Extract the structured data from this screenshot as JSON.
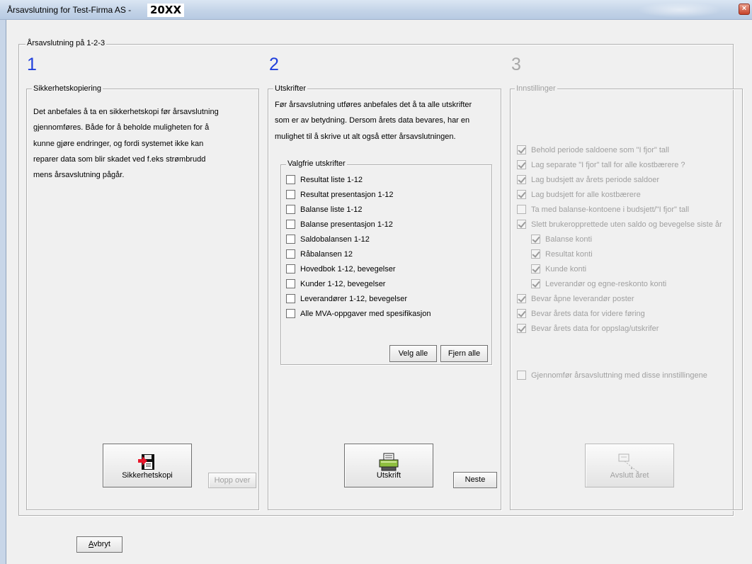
{
  "window": {
    "title": "Årsavslutning for Test-Firma AS -",
    "year": "20XX",
    "close_glyph": "×"
  },
  "main_group": {
    "label": "Årsavslutning på 1-2-3"
  },
  "step1": {
    "number": "1",
    "group_label": "Sikkerhetskopiering",
    "text_lines": [
      "Det anbefales å ta en sikkerhetskopi før årsavslutning",
      "gjennomføres. Både for å beholde muligheten for å",
      "kunne gjøre endringer, og fordi systemet ikke kan",
      "reparer data som blir skadet ved f.eks strømbrudd",
      "mens årsavslutning pågår."
    ],
    "backup_button": "Sikkerhetskopi",
    "skip_button": "Hopp over"
  },
  "step2": {
    "number": "2",
    "group_label": "Utskrifter",
    "text_lines": [
      "Før årsavslutning utføres anbefales det å ta alle utskrifter",
      "som er av betydning. Dersom årets data bevares, har en",
      "mulighet til å skrive ut alt også etter årsavslutningen."
    ],
    "optional_group_label": "Valgfrie utskrifter",
    "reports": [
      "Resultat liste 1-12",
      "Resultat presentasjon 1-12",
      "Balanse liste 1-12",
      "Balanse presentasjon 1-12",
      "Saldobalansen 1-12",
      "Råbalansen 12",
      "Hovedbok 1-12, bevegelser",
      "Kunder 1-12, bevegelser",
      "Leverandører 1-12, bevegelser",
      "Alle MVA-oppgaver med spesifikasjon"
    ],
    "select_all_button": "Velg alle",
    "remove_all_button": "Fjern alle",
    "print_button": "Utskrift",
    "next_button": "Neste"
  },
  "step3": {
    "number": "3",
    "group_label": "Innstillinger",
    "settings": [
      {
        "label": "Behold periode saldoene som \"I fjor\" tall",
        "checked": true,
        "indent": false
      },
      {
        "label": "Lag separate \"I fjor\" tall for alle kostbærere ?",
        "checked": true,
        "indent": false
      },
      {
        "label": "Lag budsjett av årets periode saldoer",
        "checked": true,
        "indent": false
      },
      {
        "label": "Lag budsjett for alle kostbærere",
        "checked": true,
        "indent": false
      },
      {
        "label": "Ta med balanse-kontoene i budsjett/\"I fjor\" tall",
        "checked": false,
        "indent": false
      },
      {
        "label": "Slett brukeropprettede uten saldo og bevegelse siste år",
        "checked": true,
        "indent": false
      },
      {
        "label": "Balanse konti",
        "checked": true,
        "indent": true
      },
      {
        "label": "Resultat konti",
        "checked": true,
        "indent": true
      },
      {
        "label": "Kunde konti",
        "checked": true,
        "indent": true
      },
      {
        "label": "Leverandør og egne-reskonto konti",
        "checked": true,
        "indent": true
      },
      {
        "label": "Bevar åpne leverandør poster",
        "checked": true,
        "indent": false
      },
      {
        "label": "Bevar årets data for videre føring",
        "checked": true,
        "indent": false
      },
      {
        "label": "Bevar årets data for oppslag/utskrifer",
        "checked": true,
        "indent": false
      }
    ],
    "confirm_label": "Gjennomfør årsavsluttning med disse innstillingene",
    "finish_button": "Avslutt året"
  },
  "cancel_button": {
    "accel": "A",
    "rest": "vbryt"
  }
}
